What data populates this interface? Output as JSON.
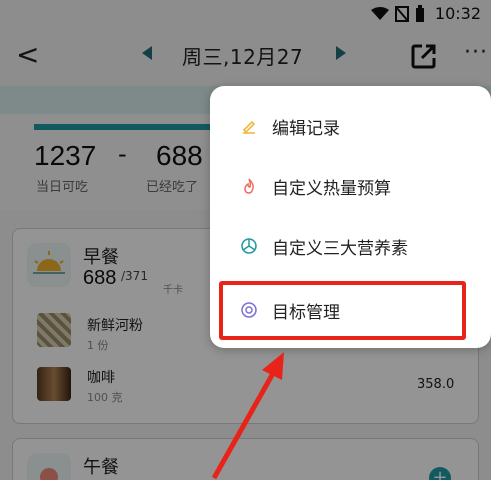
{
  "status_bar": {
    "time": "10:32",
    "icons": [
      "wifi-icon",
      "signal-off-icon",
      "battery-icon"
    ]
  },
  "header": {
    "date": "周三,12月27",
    "back": "<",
    "more": "···"
  },
  "summary": {
    "remaining": "1237",
    "separator": "-",
    "eaten": "688",
    "remaining_label": "当日可吃",
    "eaten_label": "已经吃了"
  },
  "breakfast": {
    "title": "早餐",
    "calories": "688",
    "target": "/371",
    "unit": "千卡",
    "foods": [
      {
        "name": "新鲜河粉",
        "qty": "1 份",
        "cal": ""
      },
      {
        "name": "咖啡",
        "qty": "100 克",
        "cal": "358.0"
      }
    ]
  },
  "lunch": {
    "title": "午餐"
  },
  "menu": {
    "items": [
      {
        "label": "编辑记录",
        "icon": "pencil-icon"
      },
      {
        "label": "自定义热量预算",
        "icon": "flame-icon"
      },
      {
        "label": "自定义三大营养素",
        "icon": "nutrient-icon"
      },
      {
        "label": "目标管理",
        "icon": "target-icon"
      }
    ]
  },
  "colors": {
    "accent": "#1f9aa5",
    "highlight": "#e8241a"
  }
}
